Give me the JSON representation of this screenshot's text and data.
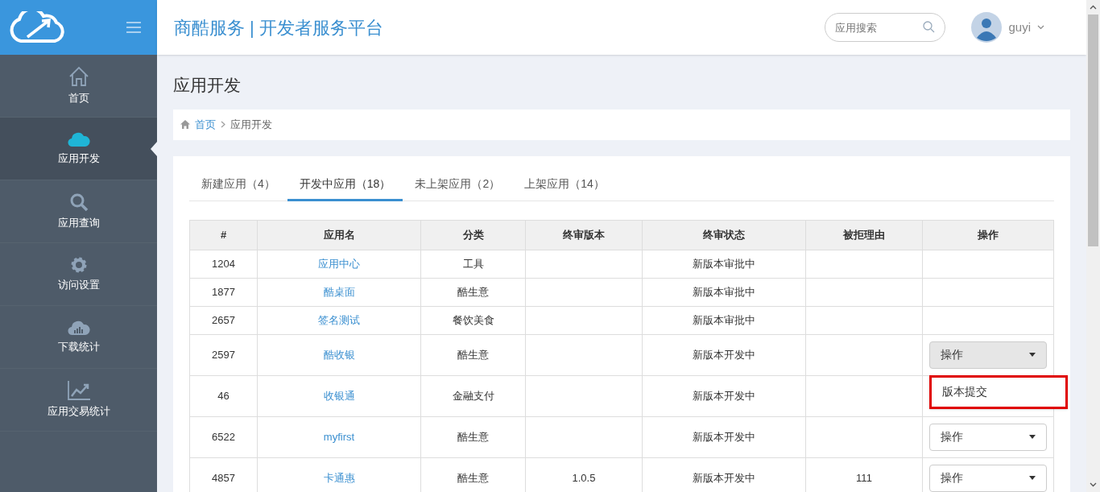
{
  "header": {
    "title": "商酷服务 | 开发者服务平台",
    "search": {
      "placeholder": "应用搜索"
    },
    "user": {
      "name": "guyi"
    }
  },
  "sidebar": {
    "items": [
      {
        "label": "首页",
        "kind": "home",
        "selected": false
      },
      {
        "label": "应用开发",
        "kind": "cloud",
        "selected": true
      },
      {
        "label": "应用查询",
        "kind": "search",
        "selected": false
      },
      {
        "label": "访问设置",
        "kind": "gear",
        "selected": false
      },
      {
        "label": "下载统计",
        "kind": "cloud-bars",
        "selected": false
      },
      {
        "label": "应用交易统计",
        "kind": "chart",
        "selected": false
      }
    ]
  },
  "page_title": "应用开发",
  "breadcrumb": [
    "首页",
    "应用开发"
  ],
  "tabs": [
    {
      "label": "新建应用（4）",
      "selected": false
    },
    {
      "label": "开发中应用（18）",
      "selected": true
    },
    {
      "label": "未上架应用（2）",
      "selected": false
    },
    {
      "label": "上架应用（14）",
      "selected": false
    }
  ],
  "table": {
    "columns": [
      "#",
      "应用名",
      "分类",
      "终审版本",
      "终审状态",
      "被拒理由",
      "操作"
    ],
    "rows": [
      {
        "id": "1204",
        "name": "应用中心",
        "category": "工具",
        "status": "新版本审批中"
      },
      {
        "id": "1877",
        "name": "酷桌面",
        "category": "酷生意",
        "status": "新版本审批中"
      },
      {
        "id": "2657",
        "name": "签名测试",
        "category": "餐饮美食",
        "status": "新版本审批中"
      },
      {
        "id": "2597",
        "name": "酷收银",
        "category": "酷生意",
        "status": "新版本开发中",
        "action": {
          "label": "操作",
          "expanded": true,
          "menu": [
            {
              "label": "版本提交",
              "highlighted": true
            }
          ]
        }
      },
      {
        "id": "46",
        "name": "收银通",
        "category": "金融支付",
        "status": "新版本开发中"
      },
      {
        "id": "6522",
        "name": "myfirst",
        "category": "酷生意",
        "status": "新版本开发中",
        "action": {
          "label": "操作",
          "expanded": false
        }
      },
      {
        "id": "4857",
        "name": "卡通惠",
        "category": "酷生意",
        "version": "1.0.5",
        "status": "新版本开发中",
        "reason": "111",
        "action": {
          "label": "操作",
          "expanded": false
        }
      }
    ]
  }
}
